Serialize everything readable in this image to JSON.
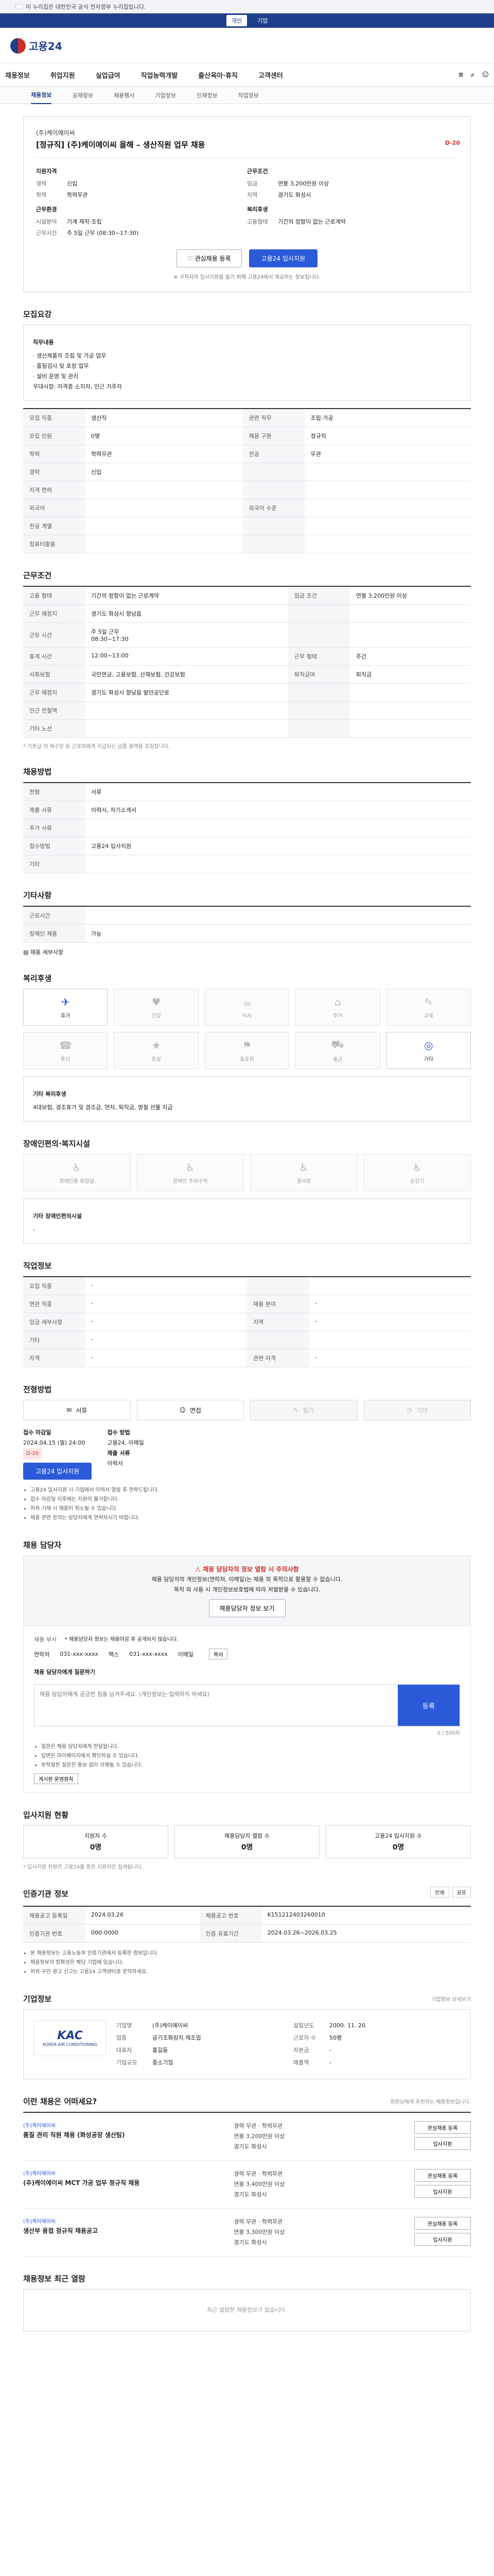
{
  "gov_banner": {
    "text": "이 누리집은 대한민국 공식 전자정부 누리집입니다."
  },
  "topbar": {
    "items": [
      "개인",
      "기업"
    ]
  },
  "header": {
    "logo": "고용24"
  },
  "gnb": {
    "items": [
      "채용정보",
      "취업지원",
      "실업급여",
      "직업능력개발",
      "출산육아·휴직",
      "고객센터"
    ],
    "icons": [
      "≡",
      "⌕",
      "☺"
    ]
  },
  "subnav": {
    "items": [
      "채용정보",
      "공채정보",
      "채용행사",
      "기업정보",
      "인재정보",
      "직업정보"
    ]
  },
  "job": {
    "company": "(주)케이에이씨",
    "title": "[정규직] (주)케이에이씨 올해 – 생산직원 업무 채용",
    "dday": "D-20",
    "left_heading": "지원자격",
    "right_heading": "근무조건",
    "left_rows": [
      {
        "k": "경력",
        "v": "신입"
      },
      {
        "k": "학력",
        "v": "학력무관"
      },
      {
        "k": "",
        "v": ""
      }
    ],
    "left_heading2": "근무환경",
    "left_rows2": [
      {
        "k": "시설분야",
        "v": "기계 제작·조립"
      },
      {
        "k": "근무시간",
        "v": "주 5일 근무 (08:30~17:30)"
      }
    ],
    "right_rows": [
      {
        "k": "임금",
        "v": "연봉 3,200만원 이상"
      },
      {
        "k": "지역",
        "v": "경기도 화성시"
      }
    ],
    "right_heading2": "복리후생",
    "right_rows2": [
      {
        "k": "고용형태",
        "v": "기간의 정함이 없는 근로계약"
      }
    ],
    "scrap_label": "관심채용 등록",
    "apply_label": "고용24 입사지원",
    "notice": "※ 구직자의 입사지원을 돕기 위해 고용24에서 제공하는 정보입니다."
  },
  "duties": {
    "title": "모집요강",
    "heading": "직무내용",
    "lines": [
      "· 생산제품의 조립 및 가공 업무",
      "· 품질검사 및 포장 업무",
      "· 설비 운영 및 관리",
      "우대사항: 자격증 소지자, 인근 거주자"
    ]
  },
  "recruit_table": {
    "rows": [
      {
        "k": "모집 직종",
        "v": "생산직",
        "k2": "관련 직무",
        "v2": "조립·가공"
      },
      {
        "k": "모집 인원",
        "v": "0명",
        "k2": "채용 구분",
        "v2": "정규직"
      },
      {
        "k": "학력",
        "v": "학력무관",
        "k2": "전공",
        "v2": "무관"
      },
      {
        "k": "경력",
        "v": "신입",
        "k2": "",
        "v2": ""
      },
      {
        "k": "자격 면허",
        "v": "",
        "k2": "",
        "v2": ""
      },
      {
        "k": "외국어",
        "v": "",
        "k2": "외국어 수준",
        "v2": ""
      },
      {
        "k": "전공 계열",
        "v": "",
        "k2": "",
        "v2": ""
      },
      {
        "k": "컴퓨터활용",
        "v": "",
        "k2": "",
        "v2": ""
      }
    ]
  },
  "conditions": {
    "title": "근무조건",
    "rows": [
      {
        "k": "고용 형태",
        "v": "기간의 정함이 없는 근로계약",
        "k2": "임금 조건",
        "v2": "연봉 3,200만원 이상"
      },
      {
        "k": "근무 예정지",
        "v": "경기도 화성시 향남읍",
        "k2": "",
        "v2": ""
      },
      {
        "k": "근무 시간",
        "v": "주 5일 근무\n08:30~17:30",
        "k2": "",
        "v2": ""
      },
      {
        "k": "휴게 시간",
        "v": "12:00~13:00",
        "k2": "근무 형태",
        "v2": "주간"
      },
      {
        "k": "사회보험",
        "v": "국민연금, 고용보험, 산재보험, 건강보험",
        "k2": "퇴직급여",
        "v2": "퇴직금"
      },
      {
        "k": "근무 예정지",
        "v": "경기도 화성시 향남읍 발안공단로",
        "k2": "",
        "v2": ""
      },
      {
        "k": "인근 전철역",
        "v": "",
        "k2": "",
        "v2": ""
      },
      {
        "k": "기타 노선",
        "v": "",
        "k2": "",
        "v2": ""
      }
    ],
    "map_label": "지도 보기",
    "notice": "* 기본급 외 제수당 등 근로자에게 지급되는 금품 총액을 포함합니다."
  },
  "screening": {
    "title": "채용방법",
    "rows": [
      {
        "k": "전형",
        "v": "서류"
      },
      {
        "k": "제출 서류",
        "v": "이력서, 자기소개서"
      },
      {
        "k": "추가 서류",
        "v": ""
      },
      {
        "k": "접수방법",
        "v": "고용24 입사지원"
      },
      {
        "k": "기타",
        "v": ""
      }
    ]
  },
  "extra": {
    "title": "기타사항",
    "rows": [
      {
        "k": "근로시간",
        "v": ""
      },
      {
        "k": "장애인 채용",
        "v": "가능"
      }
    ],
    "link": "채용 세부사항"
  },
  "welfare": {
    "title": "복리후생",
    "items": [
      {
        "icon": "✈",
        "label": "휴가",
        "on": true
      },
      {
        "icon": "♥",
        "label": "건강",
        "on": false
      },
      {
        "icon": "☕",
        "label": "식사",
        "on": false
      },
      {
        "icon": "⌂",
        "label": "주거",
        "on": false
      },
      {
        "icon": "✎",
        "label": "교육",
        "on": false
      },
      {
        "icon": "☎",
        "label": "통신",
        "on": false
      },
      {
        "icon": "★",
        "label": "포상",
        "on": false
      },
      {
        "icon": "⚑",
        "label": "동호회",
        "on": false
      },
      {
        "icon": "⛟",
        "label": "통근",
        "on": false
      },
      {
        "icon": "◎",
        "label": "기타",
        "on": true
      }
    ],
    "etc_heading": "기타 복리후생",
    "etc_text": "4대보험, 경조휴가 및 경조금, 연차, 퇴직금, 명절 선물 지급"
  },
  "pwd": {
    "title": "장애인편의·복지시설",
    "items": [
      "장애인용 화장실",
      "장애인 주차구역",
      "경사로",
      "승강기"
    ],
    "etc_heading": "기타 장애인편의시설",
    "etc_text": "-"
  },
  "hiring": {
    "title": "직업정보",
    "rows": [
      {
        "k": "모집 직종",
        "v": "-",
        "k2": "",
        "v2": ""
      },
      {
        "k": "연관 직종",
        "v": "-",
        "k2": "채용 분야",
        "v2": "-"
      },
      {
        "k": "임금 세부사항",
        "v": "-",
        "k2": "지역",
        "v2": "-"
      },
      {
        "k": "기타",
        "v": "-",
        "k2": "",
        "v2": ""
      },
      {
        "k": "자격",
        "v": "-",
        "k2": "관련 자격",
        "v2": "-"
      }
    ]
  },
  "method": {
    "title": "전형방법",
    "items": [
      {
        "icon": "✉",
        "label": "서류",
        "on": true
      },
      {
        "icon": "☺",
        "label": "면접",
        "on": true
      },
      {
        "icon": "✎",
        "label": "필기",
        "on": false
      },
      {
        "icon": "◷",
        "label": "기타",
        "on": false
      }
    ],
    "deadline_label": "접수 마감일",
    "deadline": "2024.04.15 (월) 24:00",
    "dday": "D-20",
    "method_label": "접수 방법",
    "method_val": "고용24, 이메일",
    "apply_label": "고용24 입사지원",
    "doc_label": "제출 서류",
    "doc_val": "이력서",
    "notes": [
      "고용24 입사지원 시 기업에서 이력서 열람 후 연락드립니다.",
      "접수 마감일 이후에는 지원이 불가합니다.",
      "허위 기재 시 채용이 취소될 수 있습니다.",
      "채용 관련 문의는 담당자에게 연락하시기 바랍니다."
    ]
  },
  "contact": {
    "title": "채용 담당자",
    "warn": "⚠ 채용 담당자의 정보 열람 시 주의사항",
    "line1": "채용 담당자의 개인정보(연락처, 이메일)는 채용 외 목적으로 활용할 수 없습니다.",
    "line2": "목적 외 사용 시 개인정보보호법에 따라 처벌받을 수 있습니다.",
    "view_label": "채용담당자 정보 보기",
    "dept_label": "채용 부서",
    "phone_label": "연락처",
    "phone": "031-xxx-xxxx",
    "fax_label": "팩스",
    "fax": "031-xxx-xxxx",
    "email_label": "이메일",
    "copy_label": "복사",
    "note": "* 채용담당자 정보는 채용마감 후 공개되지 않습니다.",
    "qa_heading": "채용 담당자에게 질문하기",
    "qa_placeholder": "채용 담당자에게 궁금한 점을 남겨주세요. (개인정보는 입력하지 마세요)",
    "qa_count": "0 / 500자",
    "qa_submit": "등록",
    "notes": [
      "질문은 채용 담당자에게 전달됩니다.",
      "답변은 마이페이지에서 확인하실 수 있습니다.",
      "부적절한 질문은 통보 없이 삭제될 수 있습니다."
    ],
    "rule_label": "게시판 운영원칙"
  },
  "status": {
    "title": "입사지원 현황",
    "items": [
      {
        "label": "지원자 수",
        "value": "0명"
      },
      {
        "label": "채용담당자 열람 수",
        "value": "0명"
      },
      {
        "label": "고용24 입사지원 수",
        "value": "0명"
      }
    ],
    "note": "* 입사지원 현황은 고용24를 통한 지원자만 집계됩니다."
  },
  "posting": {
    "title": "인증기관 정보",
    "tools": [
      "인쇄",
      "공유"
    ],
    "rows": [
      {
        "k": "채용공고 등록일",
        "v": "2024.03.26",
        "k2": "채용공고 번호",
        "v2": "K151212403260010"
      },
      {
        "k": "인증기관 번호",
        "v": "000-0000",
        "k2": "인증 유효기간",
        "v2": "2024.03.26~2026.03.25"
      }
    ],
    "notes": [
      "본 채용정보는 고용노동부 인증기관에서 등록한 정보입니다.",
      "채용정보의 정확성은 해당 기업에 있습니다.",
      "허위 구인 광고 신고는 고용24 고객센터로 문의하세요."
    ]
  },
  "company": {
    "title": "기업정보",
    "more_label": "기업정보 상세보기",
    "logo_main": "KAC",
    "logo_sub": "KOREA AIR CONDITIONING",
    "rows": [
      {
        "k": "기업명",
        "v": "(주)케이에이씨"
      },
      {
        "k": "설립년도",
        "v": "2000. 11. 20"
      },
      {
        "k": "업종",
        "v": "공기조화장치 제조업"
      },
      {
        "k": "근로자 수",
        "v": "50명"
      },
      {
        "k": "대표자",
        "v": "홍길동"
      },
      {
        "k": "자본금",
        "v": "-"
      },
      {
        "k": "기업규모",
        "v": "중소기업"
      },
      {
        "k": "매출액",
        "v": "-"
      }
    ]
  },
  "recommend": {
    "title": "이런 채용은 어떠세요?",
    "note": "회원님에게 추천하는 채용정보입니다.",
    "items": [
      {
        "co": "(주)케이에이씨",
        "title": "품질 관리 직원 채용 (화성공장 생산팀)",
        "lines": [
          "경력 무관 · 학력무관",
          "연봉 3,200만원 이상",
          "경기도 화성시"
        ],
        "btns": [
          "관심채용 등록",
          "입사지원"
        ]
      },
      {
        "co": "(주)케이에이씨",
        "title": "(주)케이에이씨 MCT 가공 업무 정규직 채용",
        "lines": [
          "경력 무관 · 학력무관",
          "연봉 3,400만원 이상",
          "경기도 화성시"
        ],
        "btns": [
          "관심채용 등록",
          "입사지원"
        ]
      },
      {
        "co": "(주)케이에이씨",
        "title": "생산부 용접 정규직 채용공고",
        "lines": [
          "경력 무관 · 학력무관",
          "연봉 3,300만원 이상",
          "경기도 화성시"
        ],
        "btns": [
          "관심채용 등록",
          "입사지원"
        ]
      }
    ]
  },
  "recent": {
    "title": "채용정보 최근 열람",
    "empty": "최근 열람한 채용정보가 없습니다."
  }
}
